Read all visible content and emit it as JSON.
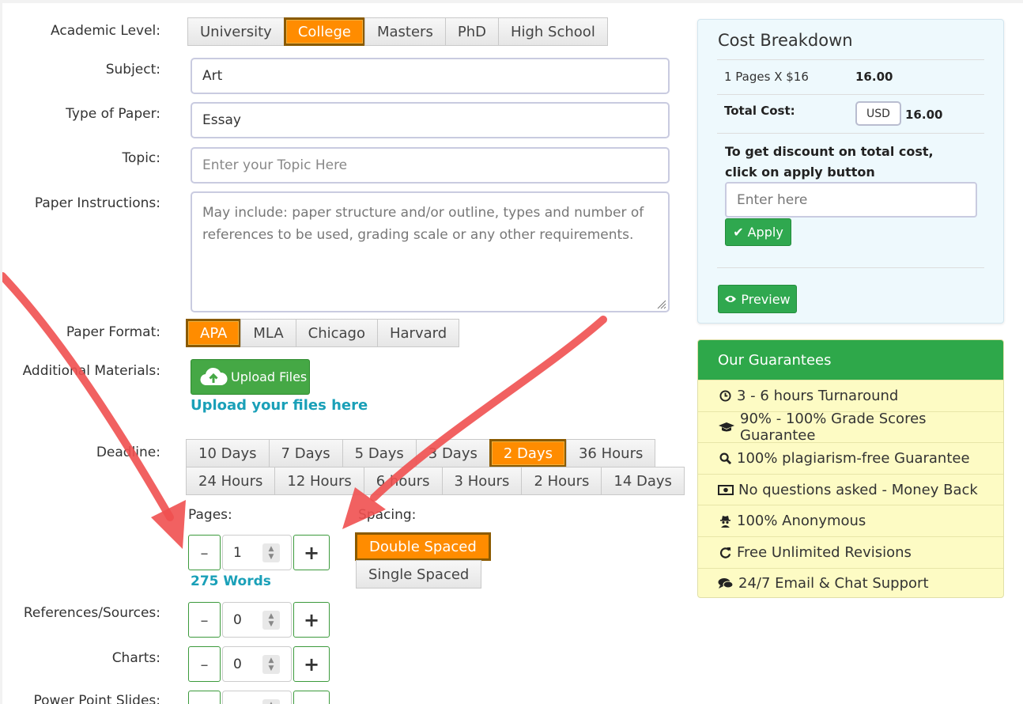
{
  "form": {
    "academic_level": {
      "label": "Academic Level:",
      "options": [
        "University",
        "College",
        "Masters",
        "PhD",
        "High School"
      ],
      "selected": "College"
    },
    "subject": {
      "label": "Subject:",
      "value": "Art"
    },
    "type_of_paper": {
      "label": "Type of Paper:",
      "value": "Essay"
    },
    "topic": {
      "label": "Topic:",
      "placeholder": "Enter your Topic Here"
    },
    "instructions": {
      "label": "Paper Instructions:",
      "placeholder": "May include: paper structure and/or outline, types and number of references to be used, grading scale or any other requirements."
    },
    "paper_format": {
      "label": "Paper Format:",
      "options": [
        "APA",
        "MLA",
        "Chicago",
        "Harvard"
      ],
      "selected": "APA"
    },
    "materials": {
      "label": "Additional Materials:",
      "upload_label": "Upload Files",
      "upload_link": "Upload your files here"
    },
    "deadline": {
      "label": "Deadline:",
      "row1": [
        "10 Days",
        "7 Days",
        "5 Days",
        "3 Days",
        "2 Days",
        "36 Hours"
      ],
      "row2": [
        "24 Hours",
        "12 Hours",
        "6 hours",
        "3 Hours",
        "2 Hours",
        "14 Days"
      ],
      "selected": "2 Days"
    },
    "pages": {
      "label": "Pages:",
      "value": "1",
      "words": "275 Words"
    },
    "spacing": {
      "label": "Spacing:",
      "options": [
        "Double Spaced",
        "Single Spaced"
      ],
      "selected": "Double Spaced"
    },
    "references": {
      "label": "References/Sources:",
      "value": "0"
    },
    "charts": {
      "label": "Charts:",
      "value": "0"
    },
    "slides": {
      "label": "Power Point Slides:"
    },
    "minus": "–",
    "plus": "+"
  },
  "cost": {
    "title": "Cost Breakdown",
    "pages_line": "1 Pages X $16",
    "pages_amount": "16.00",
    "total_label": "Total Cost:",
    "currency": "USD",
    "total_amount": "16.00",
    "discount_text": "To get discount on total cost, click on apply button",
    "discount_placeholder": "Enter here",
    "apply_label": "Apply",
    "preview_label": "Preview"
  },
  "guarantees": {
    "title": "Our Guarantees",
    "items": [
      {
        "icon": "clock-icon",
        "text": "3 - 6 hours Turnaround"
      },
      {
        "icon": "graduation-cap-icon",
        "text": "90% - 100% Grade Scores Guarantee"
      },
      {
        "icon": "search-icon",
        "text": "100% plagiarism-free Guarantee"
      },
      {
        "icon": "money-icon",
        "text": "No questions asked - Money Back"
      },
      {
        "icon": "user-secret-icon",
        "text": "100% Anonymous"
      },
      {
        "icon": "refresh-icon",
        "text": "Free Unlimited Revisions"
      },
      {
        "icon": "comments-icon",
        "text": "24/7 Email & Chat Support"
      }
    ]
  },
  "colors": {
    "active_orange": "#ff8c00",
    "green": "#2ea84a",
    "link_teal": "#1aa0b8",
    "arrow_red": "#f05050"
  }
}
